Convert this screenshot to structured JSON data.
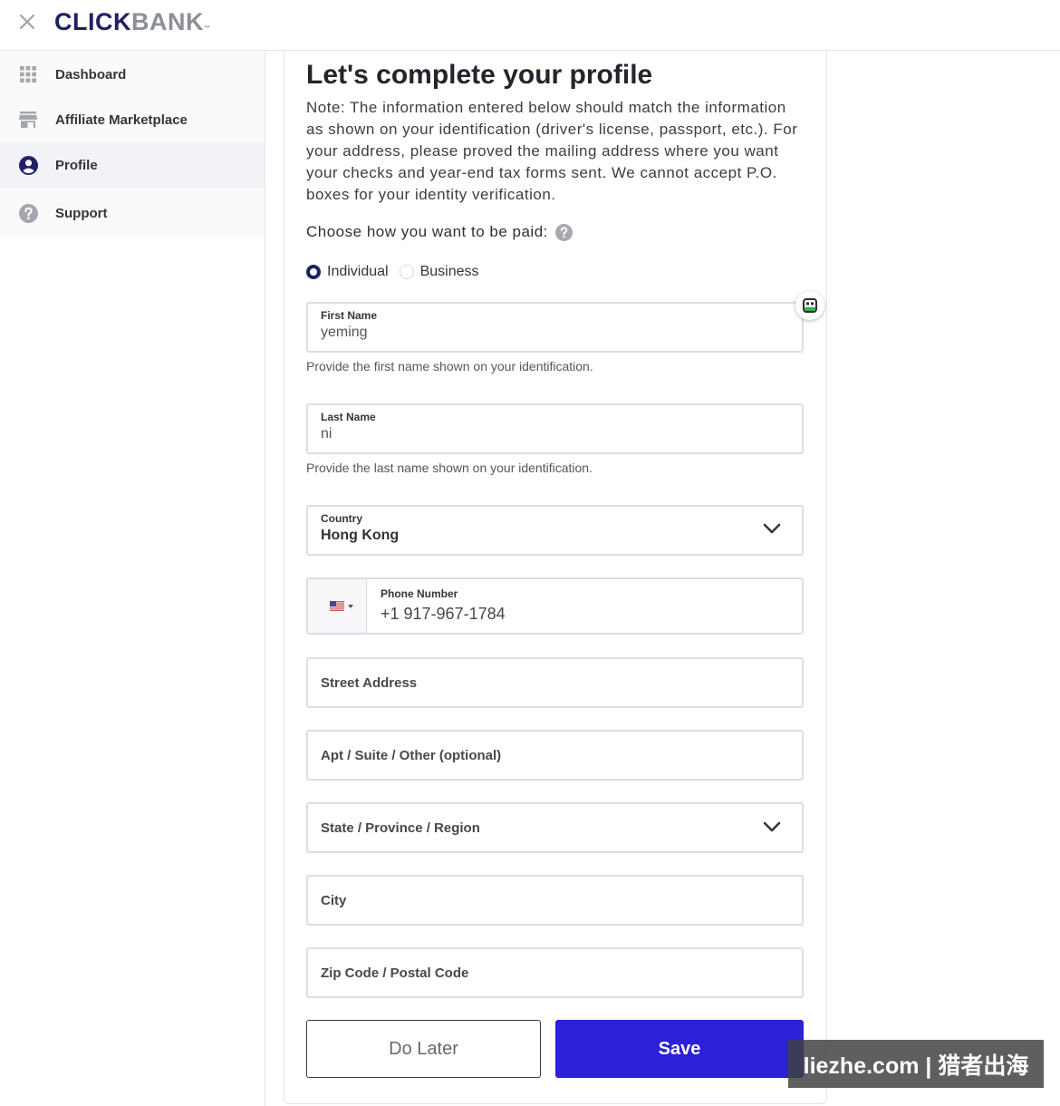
{
  "header": {
    "logo": {
      "part1": "CLICK",
      "part2": "BANK",
      "mark": "™"
    },
    "close_icon": "close-icon"
  },
  "sidebar": {
    "items": [
      {
        "label": "Dashboard",
        "icon": "grid-icon",
        "active": false
      },
      {
        "label": "Affiliate Marketplace",
        "icon": "store-icon",
        "active": false
      },
      {
        "label": "Profile",
        "icon": "user-circle-icon",
        "active": true
      },
      {
        "label": "Support",
        "icon": "question-circle-icon",
        "active": false
      }
    ]
  },
  "form": {
    "title": "Let's complete your profile",
    "note": "Note: The information entered below should match the information as shown on your identification (driver's license, passport, etc.). For your address, please proved the mailing address where you want your checks and year-end tax forms sent. We cannot accept P.O. boxes for your identity verification.",
    "payment_prompt": "Choose how you want to be paid:",
    "payment_help_icon": "question-circle-icon",
    "payment_options": [
      {
        "label": "Individual",
        "selected": true
      },
      {
        "label": "Business",
        "selected": false
      }
    ],
    "first_name": {
      "label": "First Name",
      "value": "yeming",
      "helper": "Provide the first name shown on your identification."
    },
    "last_name": {
      "label": "Last Name",
      "value": "ni",
      "helper": "Provide the last name shown on your identification."
    },
    "country": {
      "label": "Country",
      "value": "Hong Kong",
      "icon": "chevron-down-icon"
    },
    "phone": {
      "label": "Phone Number",
      "value": "+1 917-967-1784",
      "flag_icon": "us-flag-icon"
    },
    "street_address": {
      "label": "Street Address",
      "value": ""
    },
    "apt_suite": {
      "label": "Apt / Suite / Other (optional)",
      "value": ""
    },
    "state": {
      "label": "State / Province / Region",
      "value": "",
      "icon": "chevron-down-icon"
    },
    "city": {
      "label": "City",
      "value": ""
    },
    "zip": {
      "label": "Zip Code / Postal Code",
      "value": ""
    },
    "buttons": {
      "do_later": "Do Later",
      "save": "Save"
    }
  },
  "extension_icon": "robot-icon",
  "watermark": "liezhe.com | 猎者出海",
  "colors": {
    "navy": "#1e2063",
    "brand_gray": "#8d8f98",
    "accent": "#2c20d8",
    "active_icon": "#1f2267",
    "muted_icon": "#a5a7ae"
  }
}
